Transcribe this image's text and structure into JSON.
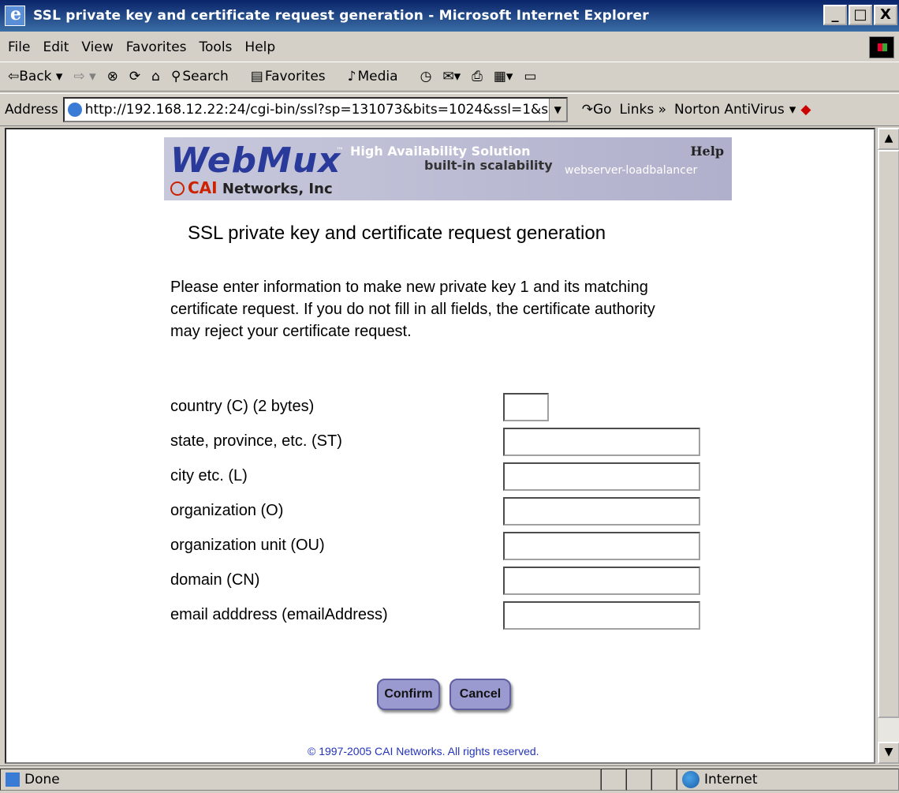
{
  "window": {
    "title": "SSL private key and certificate request generation - Microsoft Internet Explorer",
    "minimize": "_",
    "maximize": "□",
    "close": "X"
  },
  "menu": [
    "File",
    "Edit",
    "View",
    "Favorites",
    "Tools",
    "Help"
  ],
  "toolbar": {
    "back": "⇦Back ▾",
    "forward": "⇨ ▾",
    "search": "Search",
    "favorites": "Favorites",
    "media": "Media"
  },
  "address": {
    "label": "Address",
    "url": "http://192.168.12.22:24/cgi-bin/ssl?sp=131073&bits=1024&ssl=1&se",
    "go": "Go",
    "links": "Links »",
    "norton": "Norton AntiVirus"
  },
  "banner": {
    "logo": "WebMux",
    "tm": "™",
    "tagline1": "High Availability Solution",
    "tagline2": "built-in scalability",
    "tagline3": "webserver-loadbalancer",
    "help": "Help",
    "company_cai": "CAI",
    "company_rest": "Networks, Inc"
  },
  "page": {
    "heading": "SSL private key and certificate request generation",
    "intro": "Please enter information to make new private key 1 and its matching certificate request. If you do not fill in all fields, the certificate authority may reject your certificate request."
  },
  "form": {
    "fields": [
      {
        "label": "country (C) (2 bytes)",
        "value": ""
      },
      {
        "label": "state, province, etc. (ST)",
        "value": ""
      },
      {
        "label": "city etc. (L)",
        "value": ""
      },
      {
        "label": "organization (O)",
        "value": ""
      },
      {
        "label": "organization unit (OU)",
        "value": ""
      },
      {
        "label": "domain (CN)",
        "value": ""
      },
      {
        "label": "email adddress (emailAddress)",
        "value": ""
      }
    ],
    "confirm": "Confirm",
    "cancel": "Cancel"
  },
  "footer": "© 1997-2005 CAI Networks. All rights reserved.",
  "status": {
    "text": "Done",
    "zone": "Internet"
  }
}
